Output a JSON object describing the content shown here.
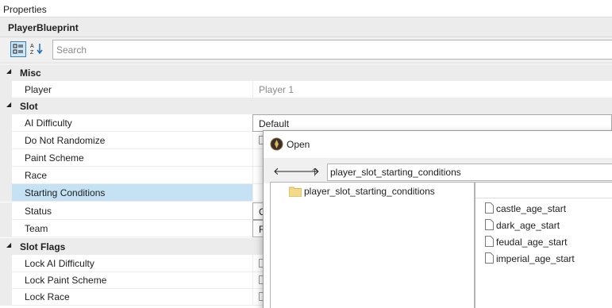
{
  "panel": {
    "title": "Properties"
  },
  "object": {
    "name": "PlayerBlueprint"
  },
  "toolbar": {
    "search_placeholder": "Search"
  },
  "grid": {
    "misc": {
      "label": "Misc",
      "rows": [
        {
          "name": "Player",
          "value": "Player 1"
        }
      ]
    },
    "slot": {
      "label": "Slot",
      "rows": [
        {
          "name": "AI Difficulty",
          "value": "Default"
        },
        {
          "name": "Do Not Randomize",
          "value": ""
        },
        {
          "name": "Paint Scheme",
          "value": ""
        },
        {
          "name": "Race",
          "value": ""
        },
        {
          "name": "Starting Conditions",
          "value": ""
        },
        {
          "name": "Status",
          "value": "C"
        },
        {
          "name": "Team",
          "value": "R"
        }
      ]
    },
    "slot_flags": {
      "label": "Slot Flags",
      "rows": [
        {
          "name": "Lock AI Difficulty"
        },
        {
          "name": "Lock Paint Scheme"
        },
        {
          "name": "Lock Race"
        }
      ]
    }
  },
  "dialog": {
    "title": "Open",
    "path": "player_slot_starting_conditions",
    "tree": [
      {
        "name": "player_slot_starting_conditions"
      }
    ],
    "files": [
      {
        "name": "castle_age_start"
      },
      {
        "name": "dark_age_start"
      },
      {
        "name": "feudal_age_start"
      },
      {
        "name": "imperial_age_start"
      }
    ]
  },
  "colors": {
    "selection": "#c4e2f4",
    "category_bg": "#ececec",
    "folder": "#f5d98a"
  }
}
